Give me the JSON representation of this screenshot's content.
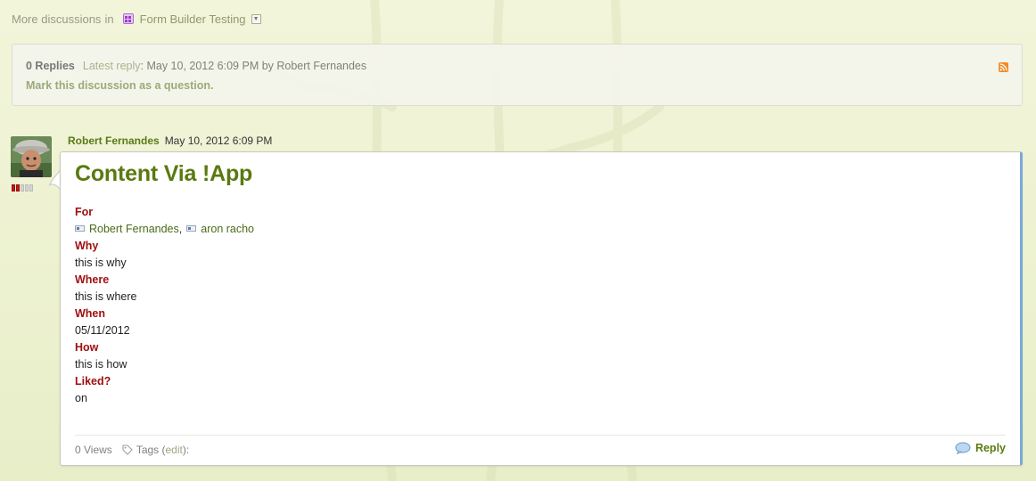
{
  "nav": {
    "more_label": "More discussions",
    "in_word": "in",
    "place_name": "Form Builder Testing"
  },
  "summary": {
    "replies": "0 Replies",
    "latest_label": "Latest reply",
    "latest_rest": ": May 10, 2012 6:09 PM by Robert Fernandes",
    "mark_question": "Mark this discussion as a question."
  },
  "post": {
    "author": "Robert Fernandes",
    "date": "May 10, 2012 6:09 PM",
    "status_level": 2,
    "status_total": 5,
    "title": "Content Via !App",
    "for_label": "For",
    "for_users": [
      "Robert Fernandes",
      "aron racho"
    ],
    "why_label": "Why",
    "why_value": "this is why",
    "where_label": "Where",
    "where_value": "this is where",
    "when_label": "When",
    "when_value": "05/11/2012",
    "how_label": "How",
    "how_value": "this is how",
    "liked_label": "Liked?",
    "liked_value": "on"
  },
  "footer": {
    "views": "0 Views",
    "tags_label": "Tags (",
    "edit": "edit",
    "tags_tail": "):",
    "reply": "Reply"
  },
  "colors": {
    "accent_green": "#5a7a10",
    "label_red": "#a01010",
    "card_side_blue": "#7aa8d8",
    "rss_orange": "#f08a24"
  },
  "icons": [
    "place-icon",
    "dropdown-arrow-icon",
    "rss-icon",
    "user-icon",
    "tag-icon",
    "reply-bubble-icon"
  ]
}
